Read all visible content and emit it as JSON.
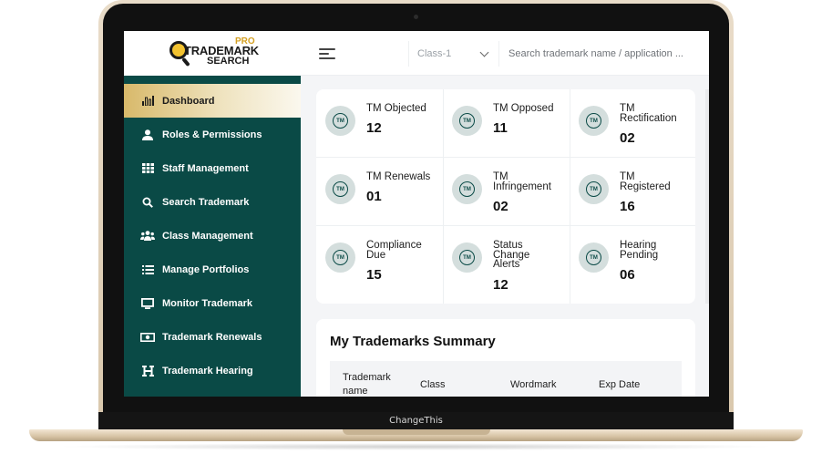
{
  "device": {
    "base_label": "ChangeThis"
  },
  "logo": {
    "pro": "PRO",
    "line1": "TRADEMARK",
    "line2": "SEARCH"
  },
  "sidebar": {
    "items": [
      {
        "label": "Dashboard",
        "icon": "bar-chart-icon",
        "active": true
      },
      {
        "label": "Roles & Permissions",
        "icon": "user-icon"
      },
      {
        "label": "Staff Management",
        "icon": "grid-icon"
      },
      {
        "label": "Search Trademark",
        "icon": "search-icon"
      },
      {
        "label": "Class Management",
        "icon": "users-icon"
      },
      {
        "label": "Manage Portfolios",
        "icon": "list-icon"
      },
      {
        "label": "Monitor Trademark",
        "icon": "monitor-icon"
      },
      {
        "label": "Trademark Renewals",
        "icon": "money-icon"
      },
      {
        "label": "Trademark Hearing",
        "icon": "h-icon"
      }
    ]
  },
  "header": {
    "class_select": "Class-1",
    "search_placeholder": "Search trademark name / application ..."
  },
  "stats": {
    "badge": "TM",
    "items": [
      {
        "label": "TM Objected",
        "value": "12"
      },
      {
        "label": "TM Opposed",
        "value": "11"
      },
      {
        "label": "TM Rectification",
        "value": "02"
      },
      {
        "label": "TM Renewals",
        "value": "01"
      },
      {
        "label": "TM Infringement",
        "value": "02"
      },
      {
        "label": "TM Registered",
        "value": "16"
      },
      {
        "label": "Compliance Due",
        "value": "15"
      },
      {
        "label": "Status Change Alerts",
        "value": "12"
      },
      {
        "label": "Hearing Pending",
        "value": "06"
      }
    ]
  },
  "summary": {
    "title": "My Trademarks Summary",
    "columns": [
      "Trademark name",
      "Class",
      "Wordmark",
      "Exp Date"
    ]
  },
  "colors": {
    "sidebar": "#0a4a46",
    "accent_gold": "#d8b96a",
    "badge_bg": "#d4dedd"
  }
}
